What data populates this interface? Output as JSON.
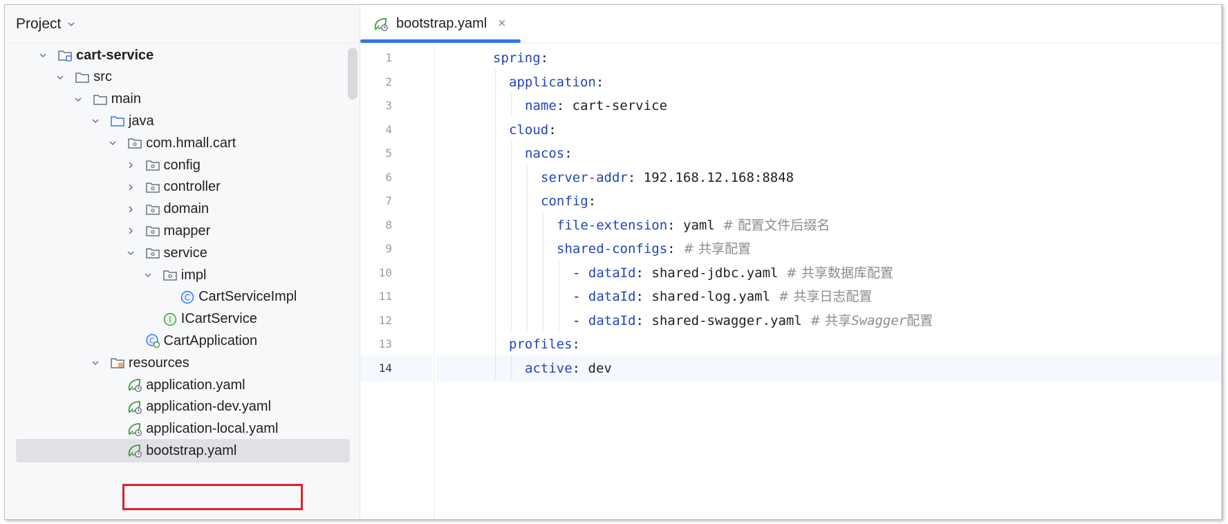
{
  "project": {
    "title": "Project",
    "tree": [
      {
        "label": "cart-service",
        "depth": 1,
        "arrow": "down",
        "icon": "module-folder-icon",
        "bold": true
      },
      {
        "label": "src",
        "depth": 2,
        "arrow": "down",
        "icon": "folder-icon"
      },
      {
        "label": "main",
        "depth": 3,
        "arrow": "down",
        "icon": "folder-icon"
      },
      {
        "label": "java",
        "depth": 4,
        "arrow": "down",
        "icon": "source-folder-icon"
      },
      {
        "label": "com.hmall.cart",
        "depth": 5,
        "arrow": "down",
        "icon": "package-icon"
      },
      {
        "label": "config",
        "depth": 6,
        "arrow": "right",
        "icon": "package-icon"
      },
      {
        "label": "controller",
        "depth": 6,
        "arrow": "right",
        "icon": "package-icon"
      },
      {
        "label": "domain",
        "depth": 6,
        "arrow": "right",
        "icon": "package-icon"
      },
      {
        "label": "mapper",
        "depth": 6,
        "arrow": "right",
        "icon": "package-icon"
      },
      {
        "label": "service",
        "depth": 6,
        "arrow": "down",
        "icon": "package-icon"
      },
      {
        "label": "impl",
        "depth": 7,
        "arrow": "down",
        "icon": "package-icon"
      },
      {
        "label": "CartServiceImpl",
        "depth": 8,
        "arrow": "none",
        "icon": "class-icon"
      },
      {
        "label": "ICartService",
        "depth": 7,
        "arrow": "none",
        "icon": "interface-icon"
      },
      {
        "label": "CartApplication",
        "depth": 6,
        "arrow": "none",
        "icon": "spring-class-icon"
      },
      {
        "label": "resources",
        "depth": 4,
        "arrow": "down",
        "icon": "resources-folder-icon"
      },
      {
        "label": "application.yaml",
        "depth": 5,
        "arrow": "none",
        "icon": "spring-yaml-icon"
      },
      {
        "label": "application-dev.yaml",
        "depth": 5,
        "arrow": "none",
        "icon": "spring-yaml-icon"
      },
      {
        "label": "application-local.yaml",
        "depth": 5,
        "arrow": "none",
        "icon": "spring-yaml-icon"
      },
      {
        "label": "bootstrap.yaml",
        "depth": 5,
        "arrow": "none",
        "icon": "spring-yaml-icon",
        "selected": true
      }
    ]
  },
  "editor": {
    "tab": {
      "label": "bootstrap.yaml",
      "close": "×",
      "icon": "spring-yaml-icon"
    },
    "current_line": 14,
    "lines": [
      {
        "n": "1",
        "indent": 0,
        "key": "spring",
        "sep": ":",
        "value": "",
        "comment": ""
      },
      {
        "n": "2",
        "indent": 1,
        "key": "application",
        "sep": ":",
        "value": "",
        "comment": ""
      },
      {
        "n": "3",
        "indent": 2,
        "key": "name",
        "sep": ":",
        "value": " cart-service",
        "comment": ""
      },
      {
        "n": "4",
        "indent": 1,
        "key": "cloud",
        "sep": ":",
        "value": "",
        "comment": ""
      },
      {
        "n": "5",
        "indent": 2,
        "key": "nacos",
        "sep": ":",
        "value": "",
        "comment": ""
      },
      {
        "n": "6",
        "indent": 3,
        "key": "server-addr",
        "sep": ":",
        "value": " 192.168.12.168:8848",
        "comment": ""
      },
      {
        "n": "7",
        "indent": 3,
        "key": "config",
        "sep": ":",
        "value": "",
        "comment": ""
      },
      {
        "n": "8",
        "indent": 4,
        "key": "file-extension",
        "sep": ":",
        "value": " yaml ",
        "comment": "# 配置文件后缀名"
      },
      {
        "n": "9",
        "indent": 4,
        "key": "shared-configs",
        "sep": ":",
        "value": " ",
        "comment": "# 共享配置"
      },
      {
        "n": "10",
        "indent": 5,
        "dash": "- ",
        "key": "dataId",
        "sep": ":",
        "value": " shared-jdbc.yaml ",
        "comment": "# 共享数据库配置"
      },
      {
        "n": "11",
        "indent": 5,
        "dash": "- ",
        "key": "dataId",
        "sep": ":",
        "value": " shared-log.yaml ",
        "comment": "# 共享日志配置"
      },
      {
        "n": "12",
        "indent": 5,
        "dash": "- ",
        "key": "dataId",
        "sep": ":",
        "value": " shared-swagger.yaml ",
        "comment_pre": "# 共享",
        "comment_italic": "Swagger",
        "comment_post": "配置"
      },
      {
        "n": "13",
        "indent": 1,
        "key": "profiles",
        "sep": ":",
        "value": "",
        "comment": ""
      },
      {
        "n": "14",
        "indent": 2,
        "key": "active",
        "sep": ":",
        "value": " dev",
        "comment": ""
      }
    ]
  }
}
